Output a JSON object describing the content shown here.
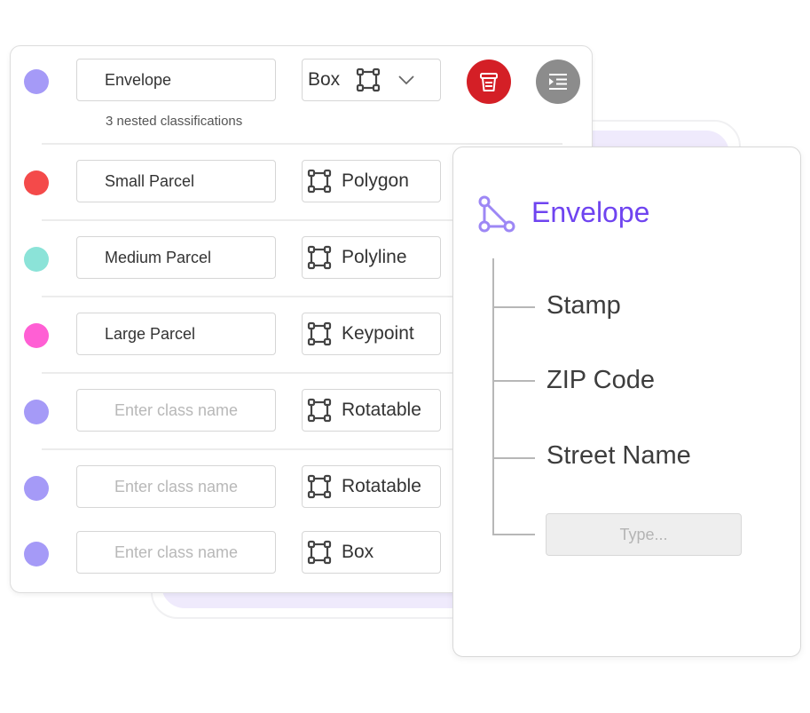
{
  "colors": {
    "accent": "#6f44f0",
    "delete": "#d41f26",
    "menu": "#8c8c8c",
    "purple_dot": "#a59af7",
    "red_dot": "#f44a4a",
    "teal_dot": "#8be3d8",
    "pink_dot": "#ff5fd4"
  },
  "classes": {
    "first": {
      "name": "Envelope",
      "type": "Box",
      "nested": "3 nested classifications"
    },
    "rows": [
      {
        "name": "Small Parcel",
        "type": "Polygon"
      },
      {
        "name": "Medium Parcel",
        "type": "Polyline"
      },
      {
        "name": "Large Parcel",
        "type": "Keypoint"
      },
      {
        "name": "",
        "placeholder": "Enter class name",
        "type": "Rotatable"
      },
      {
        "name": "",
        "placeholder": "Enter class name",
        "type": "Rotatable"
      },
      {
        "name": "",
        "placeholder": "Enter class name",
        "type": "Box"
      }
    ]
  },
  "icons": {
    "shape": "bounding-box-icon",
    "dropdown": "chevron-down-icon",
    "delete": "trash-icon",
    "menu": "indent-list-icon",
    "title": "polygon-triangle-icon"
  },
  "nested_panel": {
    "title": "Envelope",
    "items": [
      "Stamp",
      "ZIP Code",
      "Street Name"
    ],
    "input_placeholder": "Type..."
  }
}
